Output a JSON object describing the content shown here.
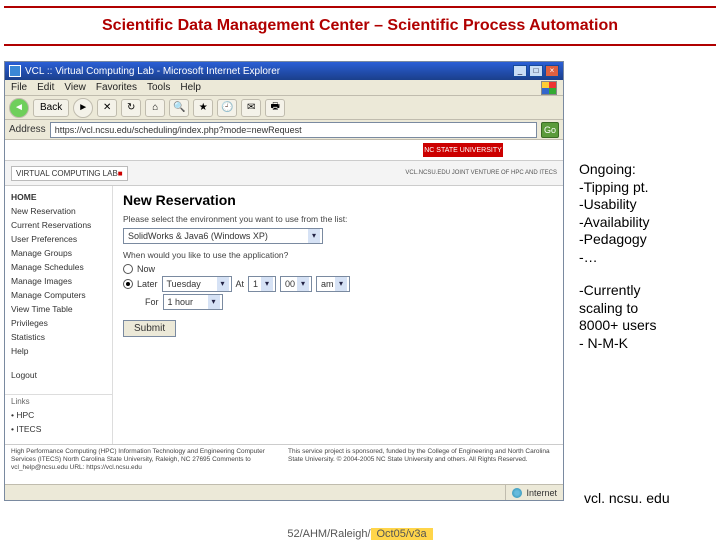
{
  "slide": {
    "title": "Scientific Data Management Center – Scientific Process Automation",
    "footer_prefix": "52/AHM/Raleigh/",
    "footer_highlight": "Oct05/v3a"
  },
  "notes": {
    "heading": "Ongoing:",
    "items": [
      "-Tipping pt.",
      "-Usability",
      "-Availability",
      "-Pedagogy",
      "-…"
    ],
    "scaling": [
      "-Currently",
      "scaling to",
      "8000+ users",
      "- N-M-K"
    ],
    "url": "vcl. ncsu. edu"
  },
  "ie": {
    "title": "VCL :: Virtual Computing Lab - Microsoft Internet Explorer",
    "menu": [
      "File",
      "Edit",
      "View",
      "Favorites",
      "Tools",
      "Help"
    ],
    "back_label": "Back",
    "address": "https://vcl.ncsu.edu/scheduling/index.php?mode=newRequest",
    "go": "Go",
    "status_zone": "Internet"
  },
  "page": {
    "nc_state": "NC STATE UNIVERSITY",
    "vcl_label": "VIRTUAL COMPUTING LAB",
    "vcl_sub": "VCL.NCSU.EDU\nJOINT VENTURE OF HPC AND ITECS",
    "nav": [
      "HOME",
      "New Reservation",
      "Current Reservations",
      "User Preferences",
      "Manage Groups",
      "Manage Schedules",
      "Manage Images",
      "Manage Computers",
      "View Time Table",
      "Privileges",
      "Statistics",
      "Help",
      "Logout"
    ],
    "links_header": "Links",
    "links": [
      "• HPC",
      "• ITECS"
    ],
    "main_heading": "New Reservation",
    "prompt1": "Please select the environment you want to use from the list:",
    "env_value": "SolidWorks & Java6 (Windows XP)",
    "prompt2": "When would you like to use the application?",
    "radio_now": "Now",
    "radio_later": "Later",
    "day_value": "Tuesday",
    "at_label": "At",
    "hour_value": "1",
    "min_value": "00",
    "ampm_value": "am",
    "for_label": "For",
    "dur_value": "1 hour",
    "submit": "Submit",
    "footer_left": "High Performance Computing (HPC)\nInformation Technology and Engineering Computer Services (ITECS)\nNorth Carolina State University, Raleigh, NC 27695\nComments to vcl_help@ncsu.edu  URL: https://vcl.ncsu.edu",
    "footer_right": "This service project is sponsored, funded by the College of Engineering and North Carolina State University. © 2004-2005 NC State University and others. All Rights Reserved."
  }
}
